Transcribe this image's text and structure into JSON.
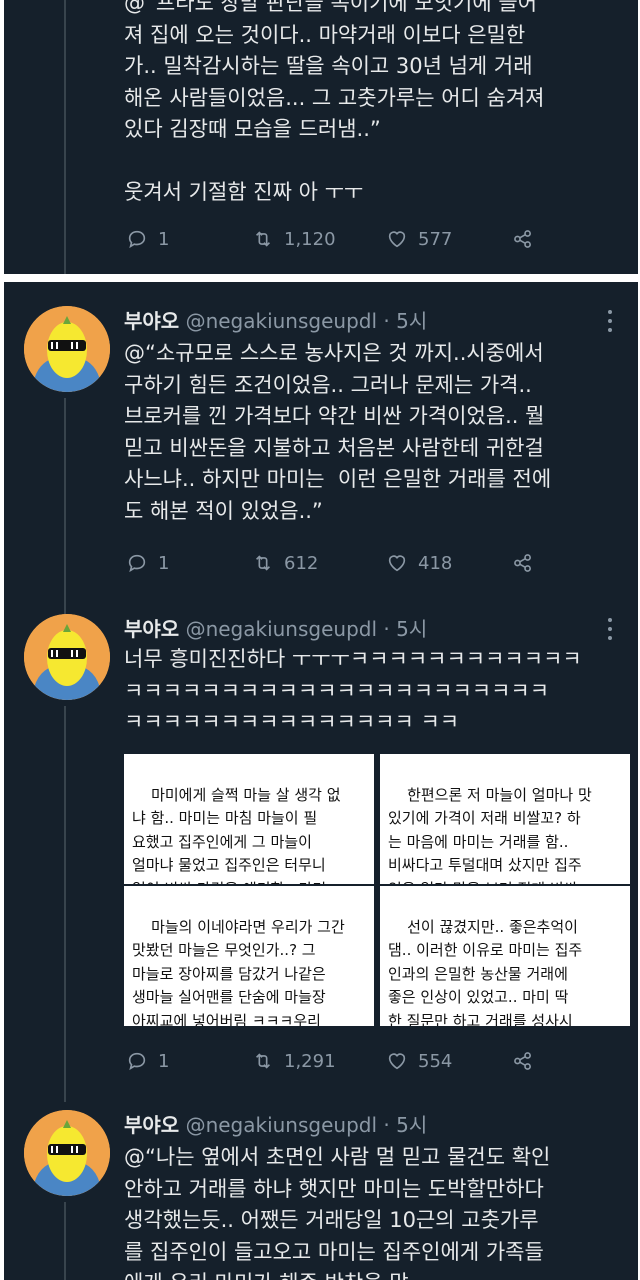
{
  "tweet0": {
    "text": "@“프라도 장발 판단을 속이기에 모잇기에 들어\n져 집에 오는 것이다.. 마약거래 이보다 은밀한\n가.. 밀착감시하는 딸을 속이고 30년 넘게 거래\n해온 사람들이었음... 그 고춧가루는 어디 숨겨져\n있다 김장때 모습을 드러냄..”\n\n웃겨서 기절함 진짜 아 ㅜㅜ",
    "replies": "1",
    "retweets": "1,120",
    "likes": "577"
  },
  "tweet1": {
    "name": "부야오",
    "handle": "@negakiunsgeupdl · 5시",
    "text": "@“소규모로 스스로 농사지은 것 까지..시중에서\n구하기 힘든 조건이었음.. 그러나 문제는 가격..\n브로커를 낀 가격보다 약간 비싼 가격이었음.. 뭘\n믿고 비싼돈을 지불하고 처음본 사람한테 귀한걸\n사느냐.. 하지만 마미는  이런 은밀한 거래를 전에\n도 해본 적이 있었음..”",
    "replies": "1",
    "retweets": "612",
    "likes": "418"
  },
  "tweet2": {
    "name": "부야오",
    "handle": "@negakiunsgeupdl · 5시",
    "text": "너무 흥미진진하다 ㅜㅜㅜㅋㅋㅋㅋㅋㅋㅋㅋㅋㅋㅋㅋ\nㅋㅋㅋㅋㅋㅋㅋㅋㅋㅋㅋㅋㅋㅋㅋㅋㅋㅋㅋㅋㅋㅋ\nㅋㅋㅋㅋㅋㅋㅋㅋㅋㅋㅋㅋㅋㅋㅋ ㅋㅋ",
    "img_left_top": "마미에게 슬쩍 마늘 살 생각 없\n냐 함.. 마미는 마침 마늘이 필\n요했고 집주인에게 그 마늘이\n얼마냐 물었고 집주인은 터무니\n없이 비싼 가격을 얘기함.. 마미\n는 ㄴ기치마 ㄱ 지즈이으 가겨",
    "img_left_bottom": "마늘의 이네야라면 우리가 그간\n맛봤던 마늘은 무엇인가..? 그\n마늘로 장아찌를 담갔거 나같은\n생마늘 실어맨를 단숨에 마늘장\n아찌교에 넣어버림 ㅋㅋㅋ우리\n가족은 아직도 그 맛을 잊지 못",
    "img_right_top": "한편으론 저 마늘이 얼마나 맛\n있기에 가격이 저래 비쌀꼬? 하\n는 마음에 마미는 거래를 함..\n비싸다고 투덜대며 샀지만 집주\n인은 일단 맛을 보면 절대 비싸\n다고 하스 어으 거이라 하 ㄱ",
    "img_right_bottom": "선이 끊겼지만.. 좋은추억이\n댐.. 이러한 이유로 마미는 집주\n인과의 은밀한 농산물 거래에\n좋은 인상이 있었고.. 마미 딱\n한 질문만 하고 거래를 성사시\n킴.. 태양초 맞나요? 였음.. ㅋㅋ",
    "replies": "1",
    "retweets": "1,291",
    "likes": "554"
  },
  "tweet3": {
    "name": "부야오",
    "handle": "@negakiunsgeupdl · 5시",
    "text": "@“나는 옆에서 초면인 사람 멀 믿고 물건도 확인\n안하고 거래를 하냐 햇지만 마미는 도박할만하다\n생각했는듯.. 어쨌든 거래당일 10근의 고춧가루\n를 집주인이 들고오고 마미는 집주인에게 가족들\n에게 우리 마미가 해준 반찬을 맞"
  },
  "colors": {
    "background": "#15202b",
    "text": "#e7e9ea",
    "muted": "#8b98a5",
    "line": "#38444d"
  }
}
